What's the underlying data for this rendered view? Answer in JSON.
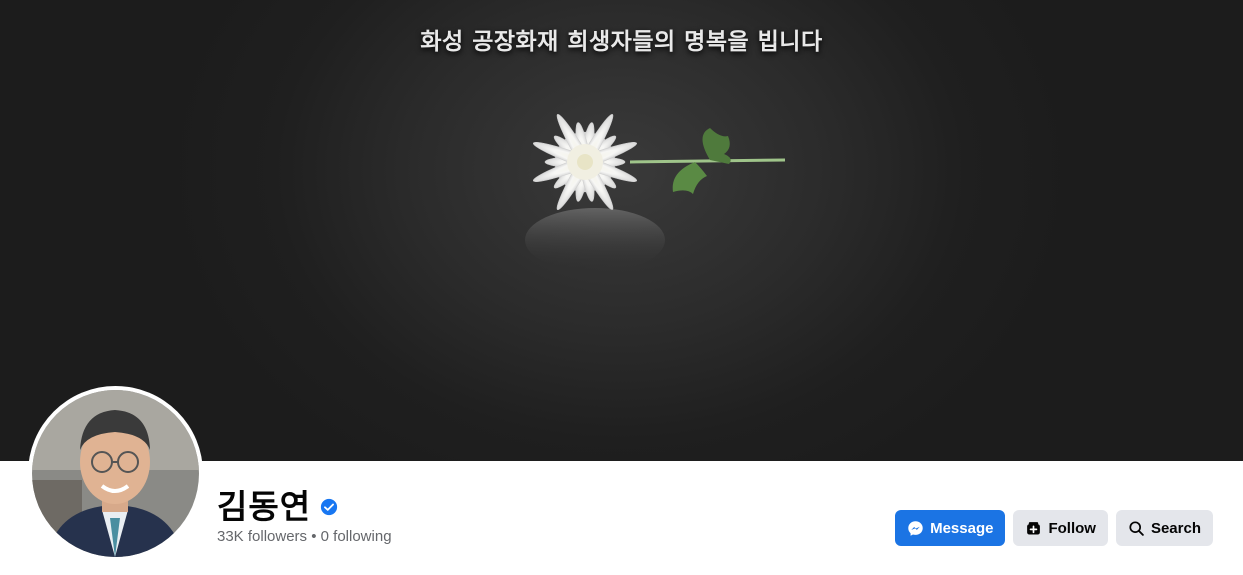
{
  "cover": {
    "caption": "화성 공장화재 희생자들의 명복을 빕니다"
  },
  "profile": {
    "name": "김동연",
    "verified": true,
    "followers_text": "33K followers",
    "separator": "•",
    "following_text": "0 following"
  },
  "actions": {
    "message_label": "Message",
    "follow_label": "Follow",
    "search_label": "Search"
  },
  "colors": {
    "primary": "#1b74e4",
    "secondary_button": "#e4e6eb",
    "verified_badge": "#1877f2",
    "muted_text": "#65676b"
  },
  "icons": {
    "message": "messenger-icon",
    "follow": "follow-icon",
    "search": "search-icon",
    "verified": "verified-badge-icon"
  }
}
